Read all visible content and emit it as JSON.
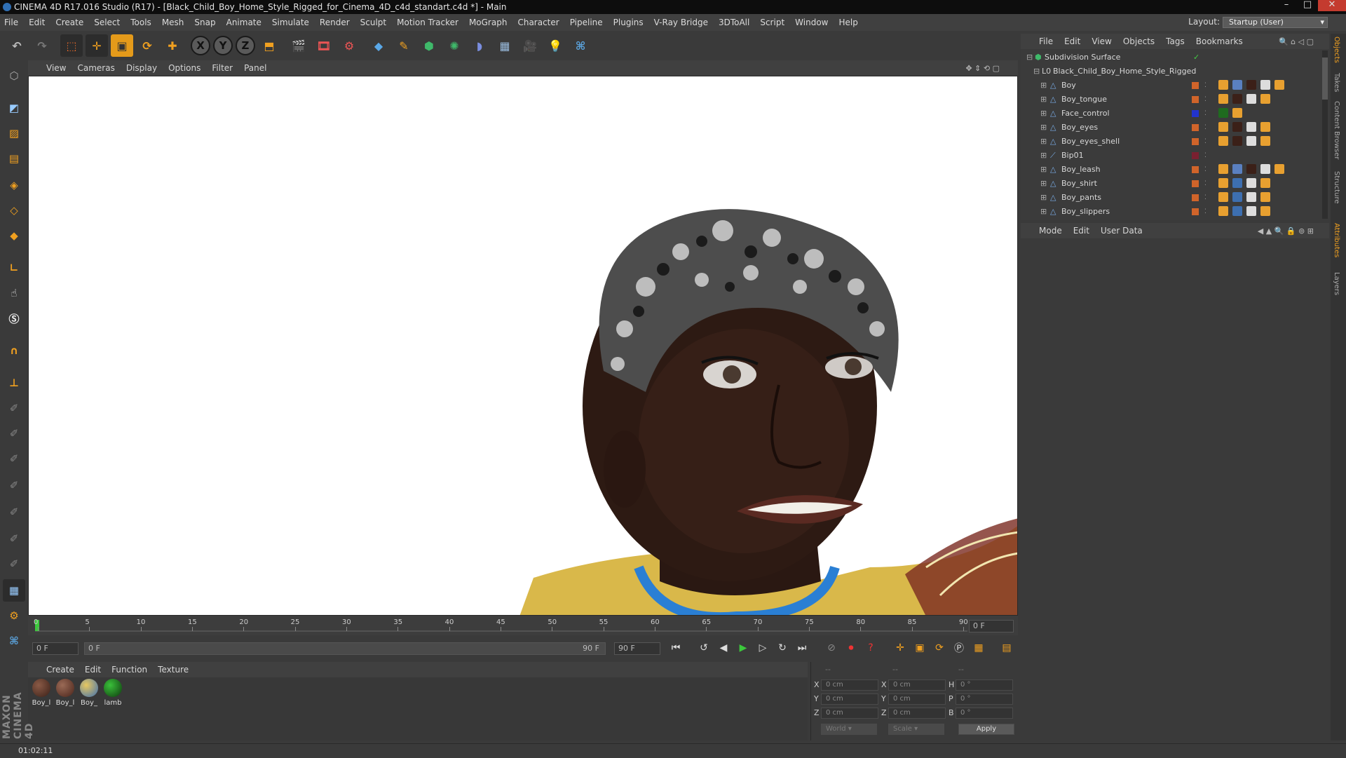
{
  "window": {
    "title": "CINEMA 4D R17.016 Studio (R17) - [Black_Child_Boy_Home_Style_Rigged_for_Cinema_4D_c4d_standart.c4d *] - Main"
  },
  "menu": [
    "File",
    "Edit",
    "Create",
    "Select",
    "Tools",
    "Mesh",
    "Snap",
    "Animate",
    "Simulate",
    "Render",
    "Sculpt",
    "Motion Tracker",
    "MoGraph",
    "Character",
    "Pipeline",
    "Plugins",
    "V-Ray Bridge",
    "3DToAll",
    "Script",
    "Window",
    "Help"
  ],
  "layout": {
    "label": "Layout:",
    "value": "Startup (User)"
  },
  "viewport_menu": [
    "View",
    "Cameras",
    "Display",
    "Options",
    "Filter",
    "Panel"
  ],
  "timeline": {
    "ticks": [
      "0",
      "5",
      "10",
      "15",
      "20",
      "25",
      "30",
      "35",
      "40",
      "45",
      "50",
      "55",
      "60",
      "65",
      "70",
      "75",
      "80",
      "85",
      "90"
    ],
    "current_frame_field": "0 F"
  },
  "transport": {
    "start": "0 F",
    "range_start": "0 F",
    "range_end": "90 F",
    "end": "90 F"
  },
  "material_menu": [
    "Create",
    "Edit",
    "Function",
    "Texture"
  ],
  "materials": [
    {
      "label": "Boy_l",
      "color": "#3b2018"
    },
    {
      "label": "Boy_l",
      "color": "#4a241a"
    },
    {
      "label": "Boy_",
      "color": "#3d6fb0"
    },
    {
      "label": "lamb",
      "color": "#1f6b1f"
    }
  ],
  "coordinates": {
    "headers": [
      "--",
      "--",
      "--"
    ],
    "rows": [
      {
        "axis": "X",
        "pos": "0 cm",
        "axis2": "X",
        "size": "0 cm",
        "axis3": "H",
        "rot": "0 °"
      },
      {
        "axis": "Y",
        "pos": "0 cm",
        "axis2": "Y",
        "size": "0 cm",
        "axis3": "P",
        "rot": "0 °"
      },
      {
        "axis": "Z",
        "pos": "0 cm",
        "axis2": "Z",
        "size": "0 cm",
        "axis3": "B",
        "rot": "0 °"
      }
    ],
    "mode": "World",
    "scale": "Scale",
    "apply": "Apply"
  },
  "object_menu": [
    "File",
    "Edit",
    "View",
    "Objects",
    "Tags",
    "Bookmarks"
  ],
  "objects": [
    {
      "name": "Subdivision Surface",
      "depth": 0,
      "color": "",
      "tags": "check"
    },
    {
      "name": "Black_Child_Boy_Home_Style_Rigged",
      "depth": 1,
      "color": "",
      "tags": ""
    },
    {
      "name": "Boy",
      "depth": 2,
      "color": "#d0642a",
      "tags": "full"
    },
    {
      "name": "Boy_tongue",
      "depth": 2,
      "color": "#d0642a",
      "tags": "mat"
    },
    {
      "name": "Face_control",
      "depth": 2,
      "color": "#2233cc",
      "tags": "green"
    },
    {
      "name": "Boy_eyes",
      "depth": 2,
      "color": "#d0642a",
      "tags": "mat"
    },
    {
      "name": "Boy_eyes_shell",
      "depth": 2,
      "color": "#d0642a",
      "tags": "mat"
    },
    {
      "name": "Bip01",
      "depth": 2,
      "color": "#7a2030",
      "tags": ""
    },
    {
      "name": "Boy_leash",
      "depth": 2,
      "color": "#d0642a",
      "tags": "full"
    },
    {
      "name": "Boy_shirt",
      "depth": 2,
      "color": "#d0642a",
      "tags": "blue"
    },
    {
      "name": "Boy_pants",
      "depth": 2,
      "color": "#d0642a",
      "tags": "blue"
    },
    {
      "name": "Boy_slippers",
      "depth": 2,
      "color": "#d0642a",
      "tags": "blue"
    }
  ],
  "attr_menu": [
    "Mode",
    "Edit",
    "User Data"
  ],
  "side_tabs": [
    "Objects",
    "Takes",
    "Content Browser",
    "Structure",
    "Attributes",
    "Layers"
  ],
  "brand": "MAXON CINEMA 4D",
  "status": {
    "time": "01:02:11"
  }
}
